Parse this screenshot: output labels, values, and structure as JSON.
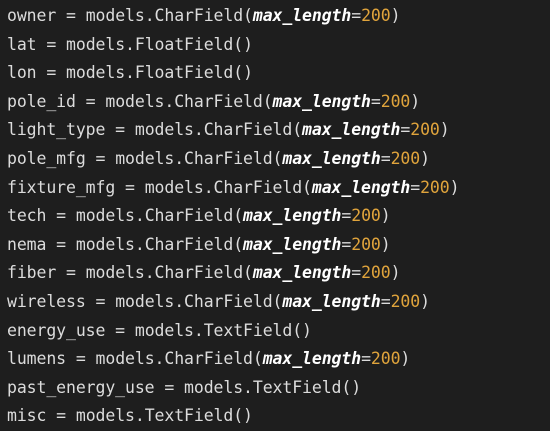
{
  "lines": [
    {
      "var": "owner",
      "model": "models.CharField",
      "kw": "max_length",
      "val": "200"
    },
    {
      "var": "lat",
      "model": "models.FloatField",
      "kw": "",
      "val": ""
    },
    {
      "var": "lon",
      "model": "models.FloatField",
      "kw": "",
      "val": ""
    },
    {
      "var": "pole_id",
      "model": "models.CharField",
      "kw": "max_length",
      "val": "200"
    },
    {
      "var": "light_type",
      "model": "models.CharField",
      "kw": "max_length",
      "val": "200"
    },
    {
      "var": "pole_mfg",
      "model": "models.CharField",
      "kw": "max_length",
      "val": "200"
    },
    {
      "var": "fixture_mfg",
      "model": "models.CharField",
      "kw": "max_length",
      "val": "200"
    },
    {
      "var": "tech",
      "model": "models.CharField",
      "kw": "max_length",
      "val": "200"
    },
    {
      "var": "nema",
      "model": "models.CharField",
      "kw": "max_length",
      "val": "200"
    },
    {
      "var": "fiber",
      "model": "models.CharField",
      "kw": "max_length",
      "val": "200"
    },
    {
      "var": "wireless",
      "model": "models.CharField",
      "kw": "max_length",
      "val": "200"
    },
    {
      "var": "energy_use",
      "model": "models.TextField",
      "kw": "",
      "val": ""
    },
    {
      "var": "lumens",
      "model": "models.CharField",
      "kw": "max_length",
      "val": "200"
    },
    {
      "var": "past_energy_use",
      "model": "models.TextField",
      "kw": "",
      "val": ""
    },
    {
      "var": "misc",
      "model": "models.TextField",
      "kw": "",
      "val": ""
    }
  ],
  "colors": {
    "background": "#1e1e1e",
    "text": "#dcdcdc",
    "keyword_arg": "#ffffff",
    "number": "#e0a43c"
  }
}
